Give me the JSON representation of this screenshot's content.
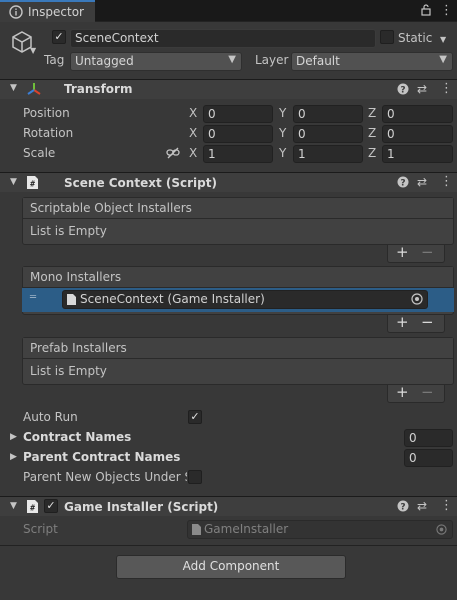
{
  "tab": {
    "title": "Inspector"
  },
  "gameobject": {
    "name": "SceneContext",
    "static_label": "Static",
    "tag_label": "Tag",
    "tag_value": "Untagged",
    "layer_label": "Layer",
    "layer_value": "Default"
  },
  "transform": {
    "title": "Transform",
    "rows": [
      {
        "label": "Position",
        "x": "0",
        "y": "0",
        "z": "0"
      },
      {
        "label": "Rotation",
        "x": "0",
        "y": "0",
        "z": "0"
      },
      {
        "label": "Scale",
        "x": "1",
        "y": "1",
        "z": "1"
      }
    ],
    "axis": {
      "x": "X",
      "y": "Y",
      "z": "Z"
    }
  },
  "scene_context": {
    "title": "Scene Context (Script)",
    "scriptable_title": "Scriptable Object Installers",
    "scriptable_empty": "List is Empty",
    "mono_title": "Mono Installers",
    "mono_item": "SceneContext (Game Installer)",
    "prefab_title": "Prefab Installers",
    "prefab_empty": "List is Empty",
    "auto_run_label": "Auto Run",
    "contract_names_label": "Contract Names",
    "contract_names_value": "0",
    "parent_contract_label": "Parent Contract Names",
    "parent_contract_value": "0",
    "parent_new_objects_label": "Parent New Objects Under Sc"
  },
  "game_installer": {
    "title": "Game Installer (Script)",
    "script_label": "Script",
    "script_value": "GameInstaller"
  },
  "add_component_label": "Add Component",
  "symbols": {
    "plus": "+",
    "minus": "−",
    "check": "✓",
    "more": "⋮",
    "help": "?",
    "settings": "⇄",
    "lock": "🔒"
  }
}
